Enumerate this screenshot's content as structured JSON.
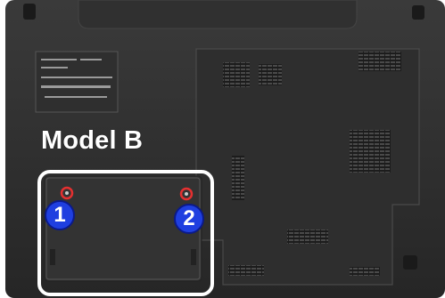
{
  "caption": {
    "model": "Model B"
  },
  "callouts": [
    {
      "number": "1"
    },
    {
      "number": "2"
    }
  ],
  "colors": {
    "chassis": "#2b2b2b",
    "highlight_frame": "#ffffff",
    "callout_fill": "#1f3fe0",
    "screw_marker": "#e53030"
  }
}
